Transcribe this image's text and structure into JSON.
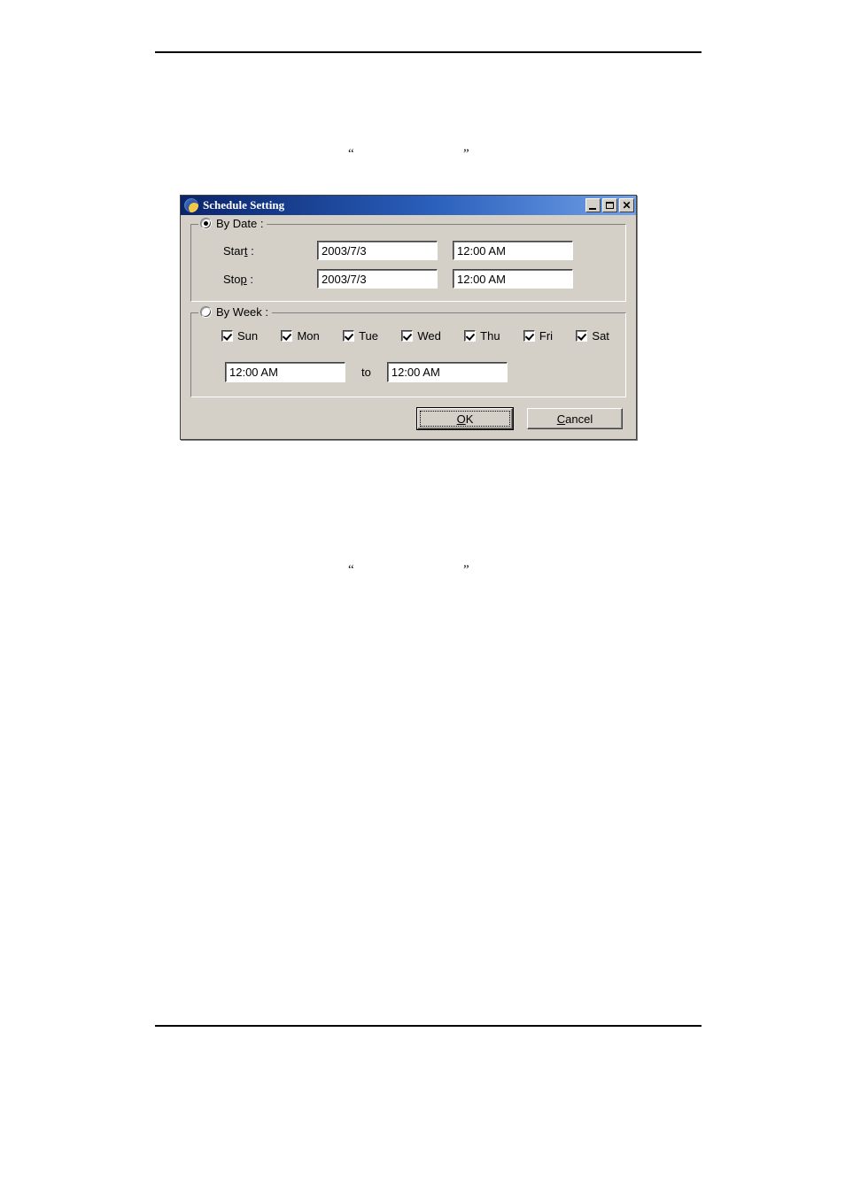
{
  "document": {
    "quote_open": "“",
    "quote_close": "”"
  },
  "dialog": {
    "title": "Schedule Setting",
    "icon": "schedule-icon",
    "window_controls": {
      "minimize": "minimize-icon",
      "maximize": "maximize-icon",
      "close": "✕"
    },
    "by_date": {
      "legend": "By Date :",
      "selected": true,
      "rows": [
        {
          "label_prefix": "Star",
          "label_accel": "t",
          "label_suffix": " :",
          "date": "2003/7/3",
          "time": "12:00 AM"
        },
        {
          "label_prefix": "Sto",
          "label_accel": "p",
          "label_suffix": " :",
          "date": "2003/7/3",
          "time": "12:00 AM"
        }
      ]
    },
    "by_week": {
      "legend": "By Week :",
      "selected": false,
      "days": [
        {
          "label": "Sun",
          "checked": true
        },
        {
          "label": "Mon",
          "checked": true
        },
        {
          "label": "Tue",
          "checked": true
        },
        {
          "label": "Wed",
          "checked": true
        },
        {
          "label": "Thu",
          "checked": true
        },
        {
          "label": "Fri",
          "checked": true
        },
        {
          "label": "Sat",
          "checked": true
        }
      ],
      "time_from": "12:00 AM",
      "to_label": "to",
      "time_until": "12:00 AM"
    },
    "buttons": {
      "ok": {
        "accel": "O",
        "rest": "K",
        "is_default": true
      },
      "cancel": {
        "accel": "C",
        "rest": "ancel",
        "is_default": false
      }
    }
  }
}
